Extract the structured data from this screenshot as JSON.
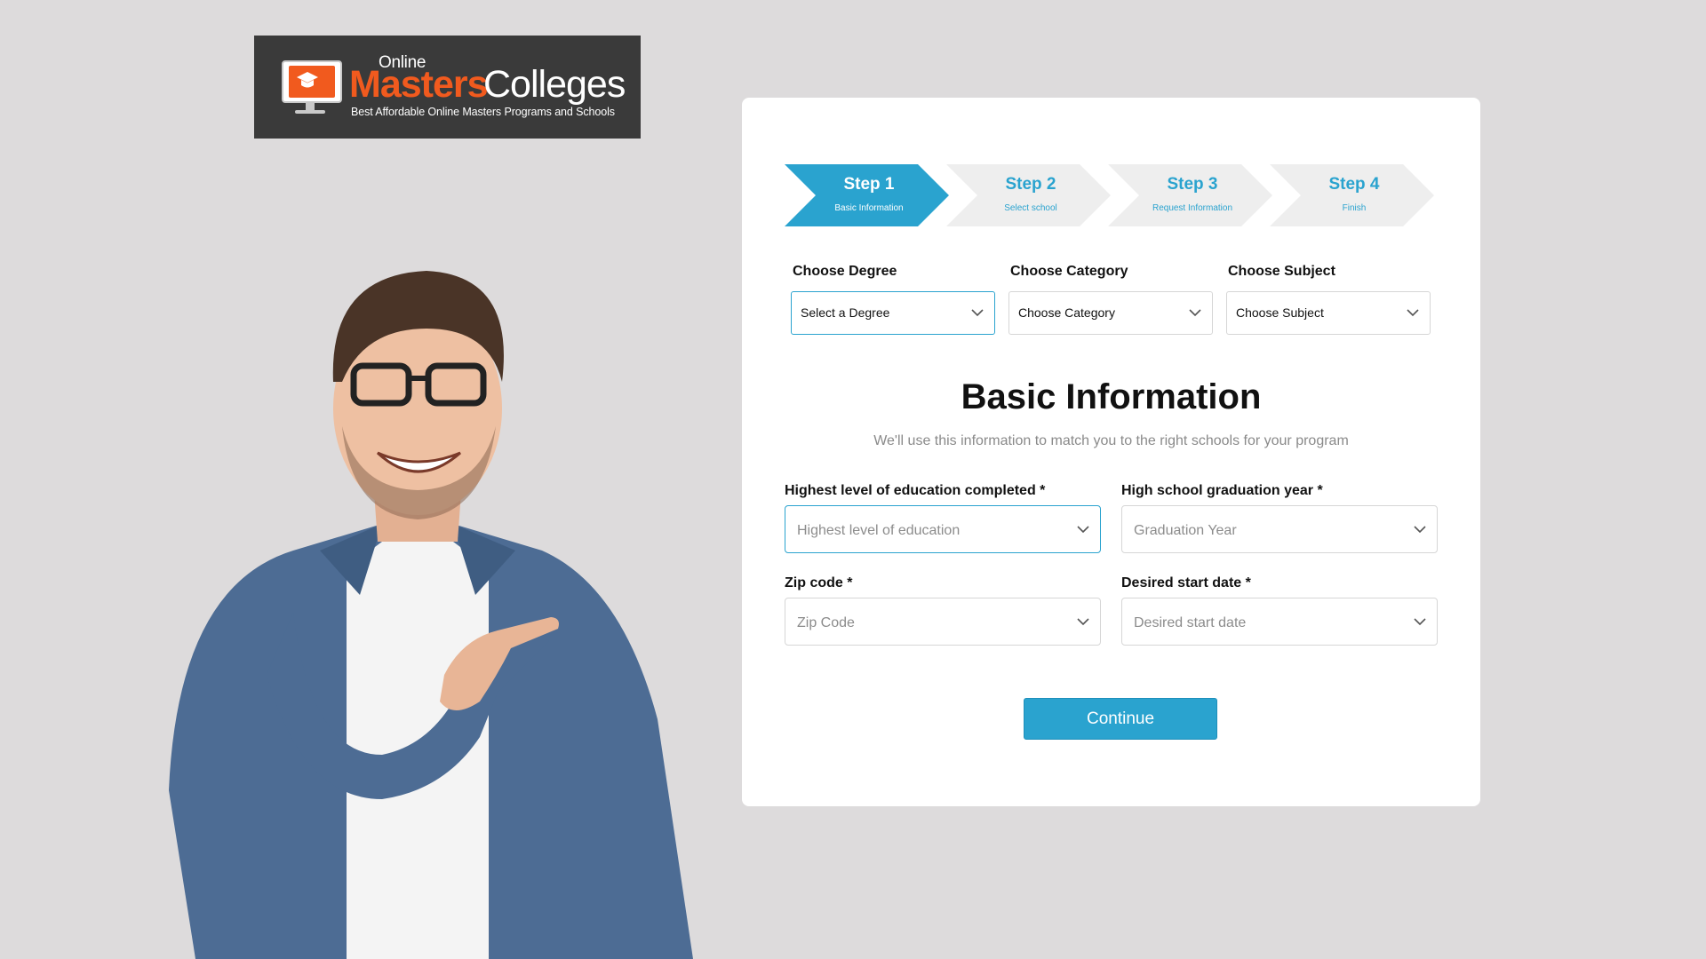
{
  "colors": {
    "accent": "#2aa3cf",
    "brand_orange": "#f15a1e",
    "background": "#dddbdc"
  },
  "logo": {
    "online": "Online",
    "masters": "Masters",
    "colleges": "Colleges",
    "tagline": "Best Affordable Online Masters Programs and Schools",
    "icon": "graduation-cap-monitor-icon"
  },
  "stepper": {
    "active_index": 0,
    "steps": [
      {
        "title": "Step 1",
        "subtitle": "Basic Information"
      },
      {
        "title": "Step 2",
        "subtitle": "Select school"
      },
      {
        "title": "Step 3",
        "subtitle": "Request Information"
      },
      {
        "title": "Step 4",
        "subtitle": "Finish"
      }
    ]
  },
  "filters": {
    "degree": {
      "label": "Choose Degree",
      "value": "Select a Degree"
    },
    "category": {
      "label": "Choose Category",
      "value": "Choose Category"
    },
    "subject": {
      "label": "Choose Subject",
      "value": "Choose Subject"
    }
  },
  "form": {
    "title": "Basic Information",
    "subtitle": "We'll use this information to match you to the right schools for your program",
    "education": {
      "label": "Highest level of education completed *",
      "placeholder": "Highest level of education"
    },
    "grad_year": {
      "label": "High school graduation year *",
      "placeholder": "Graduation Year"
    },
    "zip": {
      "label": "Zip code *",
      "placeholder": "Zip Code"
    },
    "start_date": {
      "label": "Desired start date *",
      "placeholder": "Desired start date"
    },
    "continue_label": "Continue"
  }
}
